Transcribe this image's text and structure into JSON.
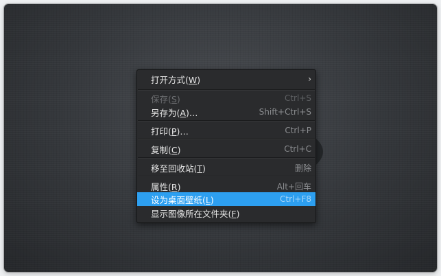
{
  "menu": {
    "items": [
      {
        "label": "打开方式(",
        "mnemonic": "W",
        "suffix": ")",
        "shortcut": "",
        "submenu": true,
        "arrow": "›"
      },
      {
        "label": "保存(",
        "mnemonic": "S",
        "suffix": ")",
        "shortcut": "Ctrl+S",
        "disabled": true
      },
      {
        "label": "另存为(",
        "mnemonic": "A",
        "suffix": ")…",
        "shortcut": "Shift+Ctrl+S"
      },
      {
        "label": "打印(",
        "mnemonic": "P",
        "suffix": ")…",
        "shortcut": "Ctrl+P"
      },
      {
        "label": "复制(",
        "mnemonic": "C",
        "suffix": ")",
        "shortcut": "Ctrl+C"
      },
      {
        "label": "移至回收站(",
        "mnemonic": "T",
        "suffix": ")",
        "shortcut": "删除"
      },
      {
        "label": "属性(",
        "mnemonic": "R",
        "suffix": ")",
        "shortcut": "Alt+回车"
      },
      {
        "label": "设为桌面壁纸(",
        "mnemonic": "L",
        "suffix": ")",
        "shortcut": "Ctrl+F8",
        "highlighted": true
      },
      {
        "label": "显示图像所在文件夹(",
        "mnemonic": "F",
        "suffix": ")",
        "shortcut": ""
      }
    ]
  },
  "colors": {
    "highlight": "#2d9ff0",
    "menu_background": "#2a2b2d",
    "window_background": "#3a3d41"
  }
}
